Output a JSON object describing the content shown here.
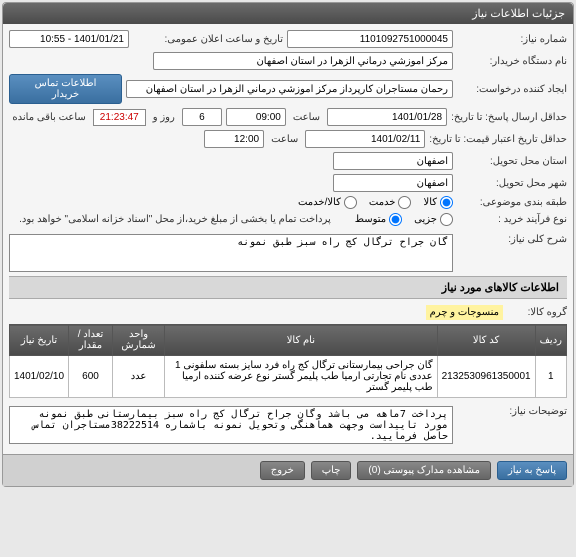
{
  "panel_title": "جزئیات اطلاعات نیاز",
  "fields": {
    "need_no_label": "شماره نیاز:",
    "need_no": "1101092751000045",
    "announce_label": "تاریخ و ساعت اعلان عمومی:",
    "announce_val": "1401/01/21 - 10:55",
    "buyer_label": "نام دستگاه خریدار:",
    "buyer_val": "مرکز آموزشي درماني الزهرا در استان اصفهان",
    "creator_label": "ایجاد کننده درخواست:",
    "creator_val": "رحمان مستاجران کارپرداز مرکز آموزشي درماني الزهرا در استان اصفهان",
    "contact_btn": "اطلاعات تماس خریدار",
    "deadline_label": "حداقل ارسال پاسخ: تا تاریخ:",
    "deadline_date": "1401/01/28",
    "time_label": "ساعت",
    "deadline_time": "09:00",
    "day_and": "روز و",
    "countdown_val": "21:23:47",
    "remain_label": "ساعت باقی مانده",
    "days_val": "6",
    "validity_label": "حداقل تاریخ اعتبار قیمت: تا تاریخ:",
    "validity_date": "1401/02/11",
    "validity_time": "12:00",
    "deliver_city_label": "شهر محل تحویل:",
    "deliver_city": "اصفهان",
    "deliver_prov_label": "استان محل تحویل:",
    "deliver_prov": "اصفهان",
    "category_label": "طبقه بندی موضوعی:",
    "cat_goods": "کالا",
    "cat_service": "خدمت",
    "cat_both": "کالا/خدمت",
    "purchase_type_label": "نوع فرآیند خرید :",
    "pt_small": "جزیی",
    "pt_medium": "متوسط",
    "payment_note": "پرداخت تمام یا بخشی از مبلغ خرید،از محل \"اسناد خزانه اسلامی\" خواهد بود.",
    "desc_label": "شرح کلی نیاز:",
    "desc_val": "گان جراح ترگال کج راه سبز طبق نمونه"
  },
  "items_section": "اطلاعات کالاهای مورد نیاز",
  "group_label": "گروه کالا:",
  "group_val": "منسوجات و چرم",
  "table": {
    "headers": [
      "ردیف",
      "کد کالا",
      "نام کالا",
      "واحد شمارش",
      "تعداد / مقدار",
      "تاریخ نیاز"
    ],
    "row": {
      "idx": "1",
      "code": "2132530961350001",
      "name": "گان جراحی بیمارستانی ترگال کج راه فرد سایز بسته سلفونی 1 عددی نام تجارتی ارمیا طب پلیمر گستر نوع عرضه کننده ارمیا طب پلیمر گستر",
      "unit": "عدد",
      "qty": "600",
      "date": "1401/02/10"
    }
  },
  "remarks_label": "توضیحات نیاز:",
  "remarks_val": "پرداخت 7ماهه می باشد وگان جراح ترگال کج راه سبز بیمارستانی طبق نمونه مورد تاییداست وجهت هماهنگی وتحویل نمونه باشماره 38222514مستاجران تماس حاصل فرمایید.",
  "footer": {
    "reply": "پاسخ به نیاز",
    "attach": "مشاهده مدارک پیوستی (0)",
    "print": "چاپ",
    "exit": "خروج"
  }
}
